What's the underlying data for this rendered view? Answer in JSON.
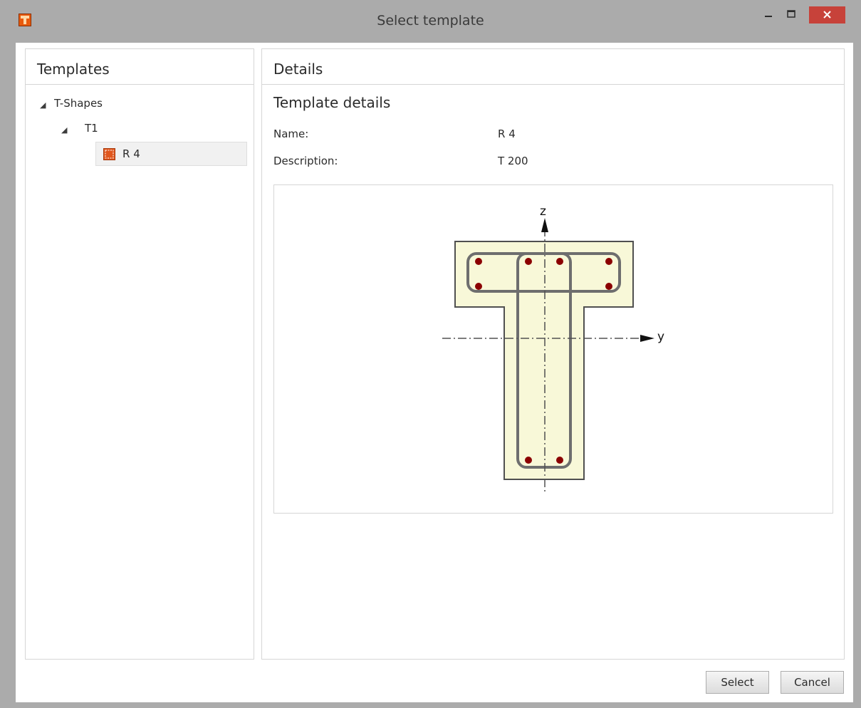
{
  "window": {
    "title": "Select template",
    "close_glyph": "×",
    "minimize_glyph": "–",
    "maximize_glyph": "□",
    "app_icon": "template-app-icon",
    "accent_close": "#c7423a"
  },
  "templates_panel": {
    "header": "Templates",
    "tree": {
      "group": "T-Shapes",
      "subgroup": "T1",
      "item": "R 4"
    },
    "expand_glyph": "◢"
  },
  "details_panel": {
    "header": "Details",
    "section_title": "Template details",
    "fields": [
      {
        "label": "Name:",
        "value": "R 4"
      },
      {
        "label": "Description:",
        "value": "T 200"
      }
    ],
    "preview": {
      "z_axis": "z",
      "y_axis": "y",
      "concrete_color": "#f8f8d8",
      "rebar_color": "#8b0000",
      "stirrup_color": "#6e6e6e"
    }
  },
  "buttons": {
    "select": "Select",
    "cancel": "Cancel"
  }
}
